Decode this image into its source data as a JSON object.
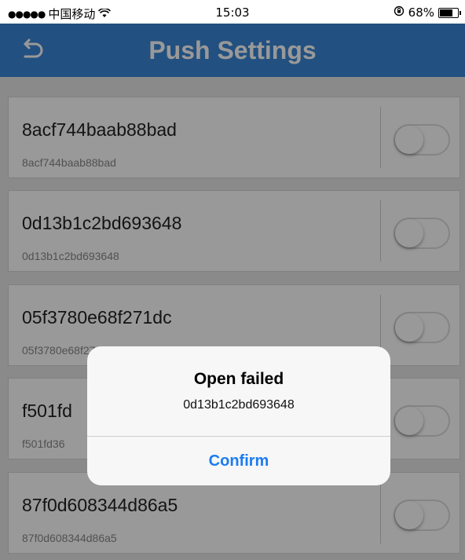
{
  "status_bar": {
    "signal": "●●●●●",
    "carrier": "中国移动",
    "wifi_icon": "wifi-icon",
    "time": "15:03",
    "lock_icon": "orientation-lock-icon",
    "battery": "68%",
    "battery_level": 0.68
  },
  "nav": {
    "back_icon": "back-arrow-icon",
    "title": "Push Settings",
    "background": "#3a86d6"
  },
  "devices": [
    {
      "name": "8acf744baab88bad",
      "sub": "8acf744baab88bad",
      "enabled": false
    },
    {
      "name": "0d13b1c2bd693648",
      "sub": "0d13b1c2bd693648",
      "enabled": false
    },
    {
      "name": "05f3780e68f271dc",
      "sub": "05f3780e68f271dc",
      "enabled": false
    },
    {
      "name": "f501fd",
      "sub": "f501fd36",
      "enabled": false
    },
    {
      "name": "87f0d608344d86a5",
      "sub": "87f0d608344d86a5",
      "enabled": false
    }
  ],
  "dialog": {
    "title": "Open failed",
    "message": "0d13b1c2bd693648",
    "confirm_label": "Confirm",
    "accent": "#1a7cf3"
  }
}
